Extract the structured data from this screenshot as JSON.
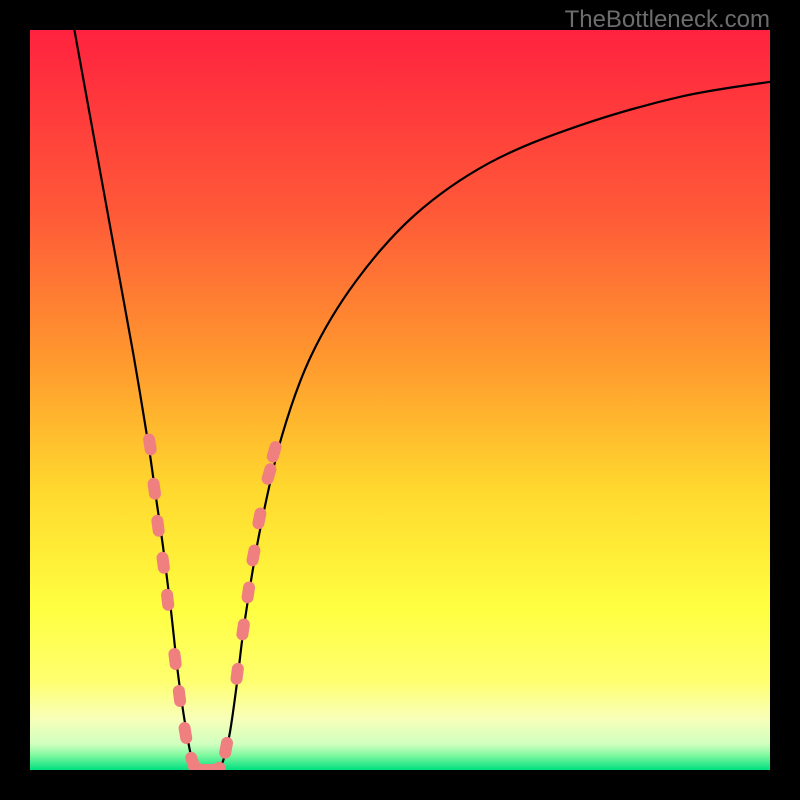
{
  "watermark": "TheBottleneck.com",
  "colors": {
    "black": "#000000",
    "gradient_top": "#ff223f",
    "gradient_mid1": "#ff8030",
    "gradient_mid2": "#ffe030",
    "gradient_mid3": "#ffff60",
    "gradient_low": "#f5ffb0",
    "gradient_bottom": "#00e080",
    "curve": "#000000",
    "marker": "#f08080",
    "watermark": "#6d6d6d"
  },
  "chart_data": {
    "type": "line",
    "title": "",
    "xlabel": "",
    "ylabel": "",
    "xlim": [
      0,
      100
    ],
    "ylim": [
      0,
      100
    ],
    "curve": {
      "x": [
        6,
        8,
        10,
        12,
        14,
        16,
        17,
        18,
        19,
        20,
        21,
        22,
        23,
        24,
        25,
        26,
        27,
        28,
        29,
        31,
        34,
        38,
        44,
        52,
        62,
        74,
        88,
        100
      ],
      "y": [
        100,
        89,
        78,
        67,
        56,
        44,
        37,
        30,
        22,
        13,
        6,
        1,
        0,
        0,
        0,
        1,
        5,
        12,
        20,
        32,
        45,
        56,
        66,
        75,
        82,
        87,
        91,
        93
      ]
    },
    "markers": [
      {
        "x": 16.2,
        "y": 44
      },
      {
        "x": 16.8,
        "y": 38
      },
      {
        "x": 17.3,
        "y": 33
      },
      {
        "x": 18.0,
        "y": 28
      },
      {
        "x": 18.6,
        "y": 23
      },
      {
        "x": 19.6,
        "y": 15
      },
      {
        "x": 20.2,
        "y": 10
      },
      {
        "x": 21.0,
        "y": 5
      },
      {
        "x": 22.0,
        "y": 1
      },
      {
        "x": 23.0,
        "y": 0
      },
      {
        "x": 24.0,
        "y": 0
      },
      {
        "x": 25.0,
        "y": 0
      },
      {
        "x": 26.5,
        "y": 3
      },
      {
        "x": 28.0,
        "y": 13
      },
      {
        "x": 28.8,
        "y": 19
      },
      {
        "x": 29.5,
        "y": 24
      },
      {
        "x": 30.2,
        "y": 29
      },
      {
        "x": 31.0,
        "y": 34
      },
      {
        "x": 32.3,
        "y": 40
      },
      {
        "x": 33.0,
        "y": 43
      }
    ]
  }
}
